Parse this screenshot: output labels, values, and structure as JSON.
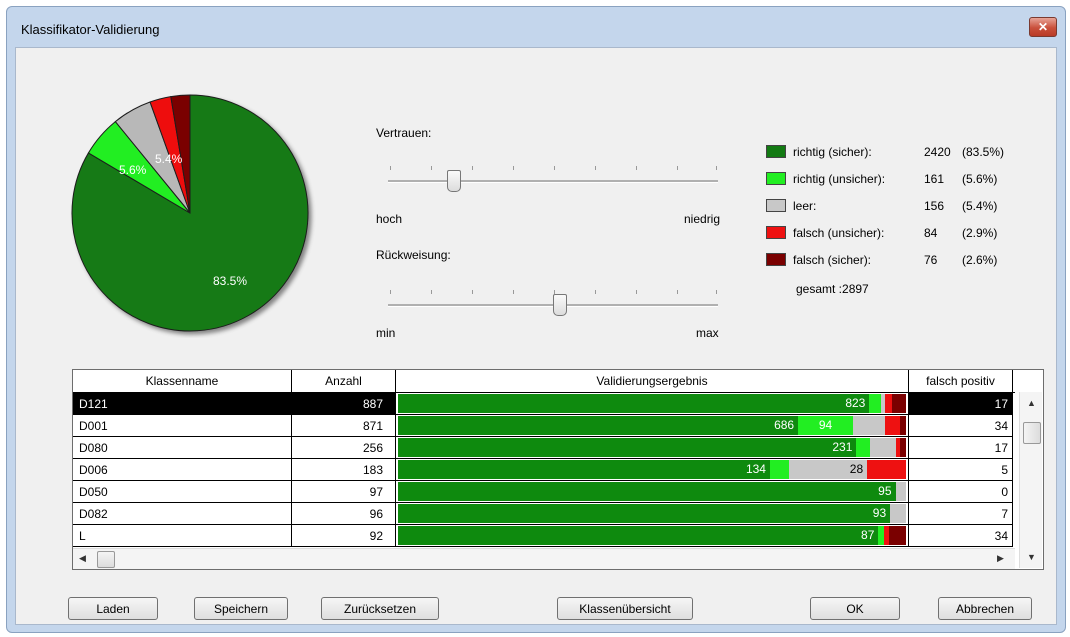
{
  "window": {
    "title": "Klassifikator-Validierung",
    "close_label": "✕"
  },
  "pie": {
    "labels": [
      "83.5%",
      "5.6%",
      "5.4%"
    ],
    "colors": {
      "richtig_sicher": "#137a13",
      "richtig_unsicher": "#22ee22",
      "leer": "#b8b8b8",
      "falsch_unsicher": "#ee1111",
      "falsch_sicher": "#7a0000"
    },
    "fractions": [
      0.835,
      0.056,
      0.054,
      0.029,
      0.026
    ]
  },
  "sliders": {
    "vertrauen": {
      "label": "Vertrauen:",
      "min_label": "hoch",
      "max_label": "niedrig",
      "value": 0.2
    },
    "rueckweisung": {
      "label": "Rückweisung:",
      "min_label": "min",
      "max_label": "max",
      "value": 0.52
    }
  },
  "legend": {
    "items": [
      {
        "label": "richtig (sicher):",
        "count": "2420",
        "pct": "(83.5%)",
        "color": "#137a13"
      },
      {
        "label": "richtig (unsicher):",
        "count": "161",
        "pct": "(5.6%)",
        "color": "#22ee22"
      },
      {
        "label": "leer:",
        "count": "156",
        "pct": "(5.4%)",
        "color": "#c8c8c8"
      },
      {
        "label": "falsch (unsicher):",
        "count": "84",
        "pct": "(2.9%)",
        "color": "#ee1111"
      },
      {
        "label": "falsch (sicher):",
        "count": "76",
        "pct": "(2.6%)",
        "color": "#7a0000"
      }
    ],
    "total": "gesamt :2897"
  },
  "table": {
    "columns": [
      "Klassenname",
      "Anzahl",
      "Validierungsergebnis",
      "falsch positiv"
    ],
    "rows": [
      {
        "name": "D121",
        "count": "887",
        "fp": "17",
        "selected": true,
        "segments": [
          {
            "value": 823,
            "label": "823"
          },
          {
            "value": 20,
            "label": ""
          },
          {
            "value": 8,
            "label": ""
          },
          {
            "value": 12,
            "label": ""
          },
          {
            "value": 24,
            "label": ""
          }
        ]
      },
      {
        "name": "D001",
        "count": "871",
        "fp": "34",
        "segments": [
          {
            "value": 686,
            "label": "686"
          },
          {
            "value": 94,
            "label": "94"
          },
          {
            "value": 55,
            "label": ""
          },
          {
            "value": 26,
            "label": ""
          },
          {
            "value": 10,
            "label": ""
          }
        ]
      },
      {
        "name": "D080",
        "count": "256",
        "fp": "17",
        "segments": [
          {
            "value": 231,
            "label": "231"
          },
          {
            "value": 7,
            "label": ""
          },
          {
            "value": 13,
            "label": ""
          },
          {
            "value": 2,
            "label": ""
          },
          {
            "value": 3,
            "label": ""
          }
        ]
      },
      {
        "name": "D006",
        "count": "183",
        "fp": "5",
        "segments": [
          {
            "value": 134,
            "label": "134"
          },
          {
            "value": 7,
            "label": ""
          },
          {
            "value": 28,
            "label": "28"
          },
          {
            "value": 14,
            "label": ""
          },
          {
            "value": 0,
            "label": ""
          }
        ]
      },
      {
        "name": "D050",
        "count": "97",
        "fp": "0",
        "segments": [
          {
            "value": 95,
            "label": "95"
          },
          {
            "value": 0,
            "label": ""
          },
          {
            "value": 2,
            "label": ""
          },
          {
            "value": 0,
            "label": ""
          },
          {
            "value": 0,
            "label": ""
          }
        ]
      },
      {
        "name": "D082",
        "count": "96",
        "fp": "7",
        "segments": [
          {
            "value": 93,
            "label": "93"
          },
          {
            "value": 0,
            "label": ""
          },
          {
            "value": 3,
            "label": ""
          },
          {
            "value": 0,
            "label": ""
          },
          {
            "value": 0,
            "label": ""
          }
        ]
      },
      {
        "name": "L",
        "count": "92",
        "fp": "34",
        "segments": [
          {
            "value": 87,
            "label": "87"
          },
          {
            "value": 1,
            "label": ""
          },
          {
            "value": 0,
            "label": ""
          },
          {
            "value": 1,
            "label": ""
          },
          {
            "value": 3,
            "label": ""
          }
        ]
      }
    ],
    "segment_colors": [
      "#0e8a0e",
      "#22ee22",
      "#c8c8c8",
      "#ee1111",
      "#7a0000"
    ]
  },
  "buttons": {
    "laden": "Laden",
    "speichern": "Speichern",
    "zuruecksetzen": "Zurücksetzen",
    "klassenuebersicht": "Klassenübersicht",
    "ok": "OK",
    "abbrechen": "Abbrechen"
  }
}
